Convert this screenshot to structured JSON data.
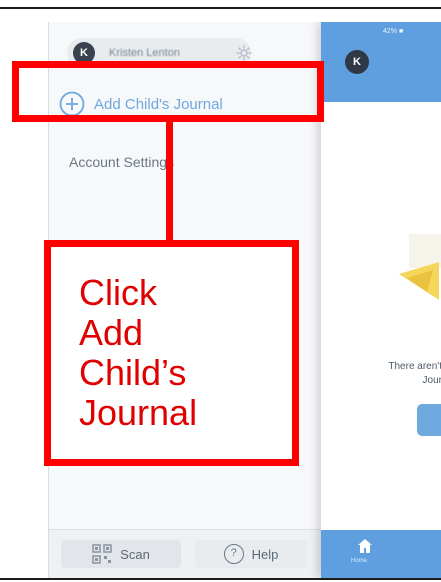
{
  "drawer": {
    "profile": {
      "avatar_initial": "K",
      "name": "Kristen Lenton",
      "settings_icon": "gear-icon"
    },
    "add_child_journal": {
      "icon": "plus-circle-icon",
      "label": "Add Child's Journal"
    },
    "account_settings": "Account Settings",
    "bottom_bar": {
      "scan": {
        "icon": "qr-code-icon",
        "label": "Scan"
      },
      "help": {
        "icon": "help-circle-icon",
        "glyph": "?",
        "label": "Help"
      }
    }
  },
  "app_panel": {
    "status": "42% ■",
    "header_avatar_initial": "K",
    "empty_text_line1": "There aren't",
    "empty_text_line2": "Jour",
    "tabbar": {
      "icon": "home-icon",
      "label": "Home"
    }
  },
  "annotation": {
    "callout_lines": [
      "Click",
      "Add",
      "Child’s",
      "Journal"
    ],
    "color": "#ff0000"
  },
  "colors": {
    "accent_blue": "#5f9fe0",
    "link_blue": "#6fa7df",
    "annotation_red": "#ff0000"
  }
}
